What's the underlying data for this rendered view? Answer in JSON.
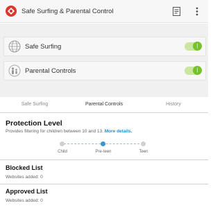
{
  "app_title": "Safe Surfing & Parental Control",
  "toggles": [
    {
      "label": "Safe Surfing",
      "on": true
    },
    {
      "label": "Parental Controls",
      "on": true
    }
  ],
  "tabs": [
    {
      "label": "Safe Surfing",
      "active": false
    },
    {
      "label": "Parental Controls",
      "active": true
    },
    {
      "label": "History",
      "active": false
    }
  ],
  "protection": {
    "title": "Protection Level",
    "description": "Provides filtering for children between 10 and 13.",
    "link": "More details.",
    "levels": [
      "Child",
      "Pre-teen",
      "Teen"
    ],
    "selected": "Pre-teen"
  },
  "blocked": {
    "title": "Blocked List",
    "count_text": "Websites added: 0"
  },
  "approved": {
    "title": "Approved List",
    "count_text": "Websites added: 0"
  },
  "colors": {
    "accent": "#3b97d3",
    "switch_on": "#76c22a",
    "brand_red": "#d63a2f"
  },
  "icons": [
    "app-logo-icon",
    "document-icon",
    "overflow-menu-icon",
    "globe-icon",
    "family-icon"
  ]
}
